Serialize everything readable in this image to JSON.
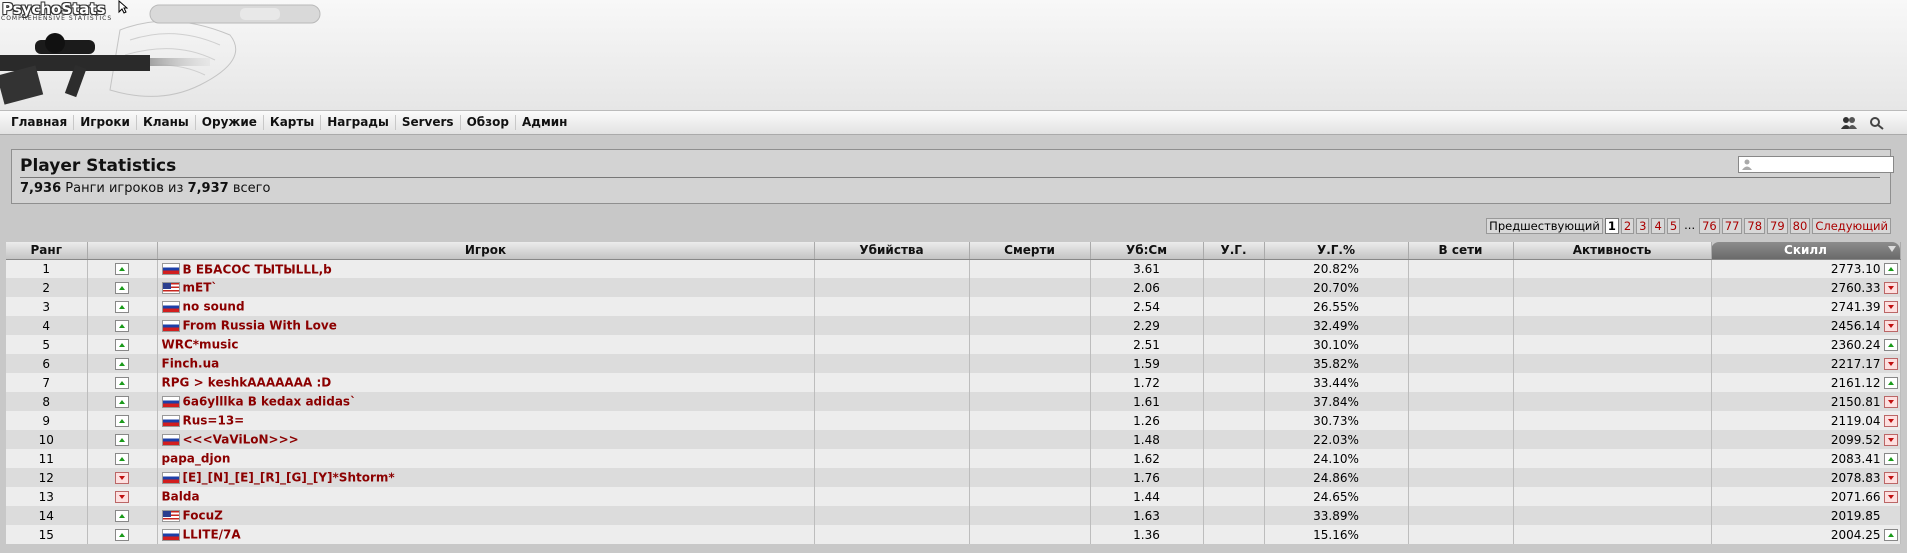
{
  "header": {
    "logo_text": "PsychoStats",
    "logo_subtext": "COMPREHENSIVE STATISTICS"
  },
  "nav": {
    "items": [
      "Главная",
      "Игроки",
      "Кланы",
      "Оружие",
      "Карты",
      "Награды",
      "Servers",
      "Обзор",
      "Админ"
    ],
    "icons": [
      "users-icon",
      "search-icon"
    ]
  },
  "title_box": {
    "title": "Player Statistics",
    "ranked_count": "7,936",
    "ranked_text": " Ранги игроков из ",
    "total_count": "7,937",
    "total_text": " всего",
    "search_placeholder": ""
  },
  "pager": {
    "prev": "Предшествующий",
    "pages_start": [
      "1",
      "2",
      "3",
      "4",
      "5"
    ],
    "ellipsis": "...",
    "pages_end": [
      "76",
      "77",
      "78",
      "79",
      "80"
    ],
    "current": "1",
    "next": "Следующий"
  },
  "table": {
    "columns": [
      "Ранг",
      "",
      "Игрок",
      "Убийства",
      "Смерти",
      "Уб:См",
      "У.Г.",
      "У.Г.%",
      "В сети",
      "Активность",
      "Скилл"
    ],
    "sorted_column": "Скилл",
    "rows": [
      {
        "rank": "1",
        "trend": "up",
        "flag": "ru",
        "player": "В ЕБАСОС ТЫТЫLLL,b",
        "kills": "",
        "deaths": "",
        "kd": "3.61",
        "hs": "",
        "hs_pct": "20.82%",
        "online": "",
        "activity": "",
        "skill": "2773.10",
        "skill_trend": "up"
      },
      {
        "rank": "2",
        "trend": "up",
        "flag": "us",
        "player": "mET`",
        "kills": "",
        "deaths": "",
        "kd": "2.06",
        "hs": "",
        "hs_pct": "20.70%",
        "online": "",
        "activity": "",
        "skill": "2760.33",
        "skill_trend": "down"
      },
      {
        "rank": "3",
        "trend": "up",
        "flag": "ru",
        "player": "no sound",
        "kills": "",
        "deaths": "",
        "kd": "2.54",
        "hs": "",
        "hs_pct": "26.55%",
        "online": "",
        "activity": "",
        "skill": "2741.39",
        "skill_trend": "down"
      },
      {
        "rank": "4",
        "trend": "up",
        "flag": "ru",
        "player": "From Russia With Love",
        "kills": "",
        "deaths": "",
        "kd": "2.29",
        "hs": "",
        "hs_pct": "32.49%",
        "online": "",
        "activity": "",
        "skill": "2456.14",
        "skill_trend": "down"
      },
      {
        "rank": "5",
        "trend": "up",
        "flag": "",
        "player": "WRC*music",
        "kills": "",
        "deaths": "",
        "kd": "2.51",
        "hs": "",
        "hs_pct": "30.10%",
        "online": "",
        "activity": "",
        "skill": "2360.24",
        "skill_trend": "up"
      },
      {
        "rank": "6",
        "trend": "up",
        "flag": "",
        "player": "Finch.ua",
        "kills": "",
        "deaths": "",
        "kd": "1.59",
        "hs": "",
        "hs_pct": "35.82%",
        "online": "",
        "activity": "",
        "skill": "2217.17",
        "skill_trend": "down"
      },
      {
        "rank": "7",
        "trend": "up",
        "flag": "",
        "player": "RPG > keshkAAAAAAA :D",
        "kills": "",
        "deaths": "",
        "kd": "1.72",
        "hs": "",
        "hs_pct": "33.44%",
        "online": "",
        "activity": "",
        "skill": "2161.12",
        "skill_trend": "up"
      },
      {
        "rank": "8",
        "trend": "up",
        "flag": "ru",
        "player": "6a6ylllka B kedax adidas`",
        "kills": "",
        "deaths": "",
        "kd": "1.61",
        "hs": "",
        "hs_pct": "37.84%",
        "online": "",
        "activity": "",
        "skill": "2150.81",
        "skill_trend": "down"
      },
      {
        "rank": "9",
        "trend": "up",
        "flag": "ru",
        "player": "Rus=13=",
        "kills": "",
        "deaths": "",
        "kd": "1.26",
        "hs": "",
        "hs_pct": "30.73%",
        "online": "",
        "activity": "",
        "skill": "2119.04",
        "skill_trend": "down"
      },
      {
        "rank": "10",
        "trend": "up",
        "flag": "ru",
        "player": "<<<VaViLoN>>>",
        "kills": "",
        "deaths": "",
        "kd": "1.48",
        "hs": "",
        "hs_pct": "22.03%",
        "online": "",
        "activity": "",
        "skill": "2099.52",
        "skill_trend": "down"
      },
      {
        "rank": "11",
        "trend": "up",
        "flag": "",
        "player": "papa_djon",
        "kills": "",
        "deaths": "",
        "kd": "1.62",
        "hs": "",
        "hs_pct": "24.10%",
        "online": "",
        "activity": "",
        "skill": "2083.41",
        "skill_trend": "up"
      },
      {
        "rank": "12",
        "trend": "down",
        "flag": "ru",
        "player": "[E]_[N]_[E]_[R]_[G]_[Y]*Shtorm*",
        "kills": "",
        "deaths": "",
        "kd": "1.76",
        "hs": "",
        "hs_pct": "24.86%",
        "online": "",
        "activity": "",
        "skill": "2078.83",
        "skill_trend": "down"
      },
      {
        "rank": "13",
        "trend": "down",
        "flag": "",
        "player": "Balda",
        "kills": "",
        "deaths": "",
        "kd": "1.44",
        "hs": "",
        "hs_pct": "24.65%",
        "online": "",
        "activity": "",
        "skill": "2071.66",
        "skill_trend": "down"
      },
      {
        "rank": "14",
        "trend": "up",
        "flag": "us",
        "player": "FocuZ",
        "kills": "",
        "deaths": "",
        "kd": "1.63",
        "hs": "",
        "hs_pct": "33.89%",
        "online": "",
        "activity": "",
        "skill": "2019.85",
        "skill_trend": ""
      },
      {
        "rank": "15",
        "trend": "up",
        "flag": "ru",
        "player": "LLITE/7A",
        "kills": "",
        "deaths": "",
        "kd": "1.36",
        "hs": "",
        "hs_pct": "15.16%",
        "online": "",
        "activity": "",
        "skill": "2004.25",
        "skill_trend": "up"
      }
    ]
  },
  "colors": {
    "player_link": "#8b0000",
    "trend_up": "#1a9a1a",
    "trend_down": "#c01010",
    "sorted_header": "#7a7a7a"
  }
}
